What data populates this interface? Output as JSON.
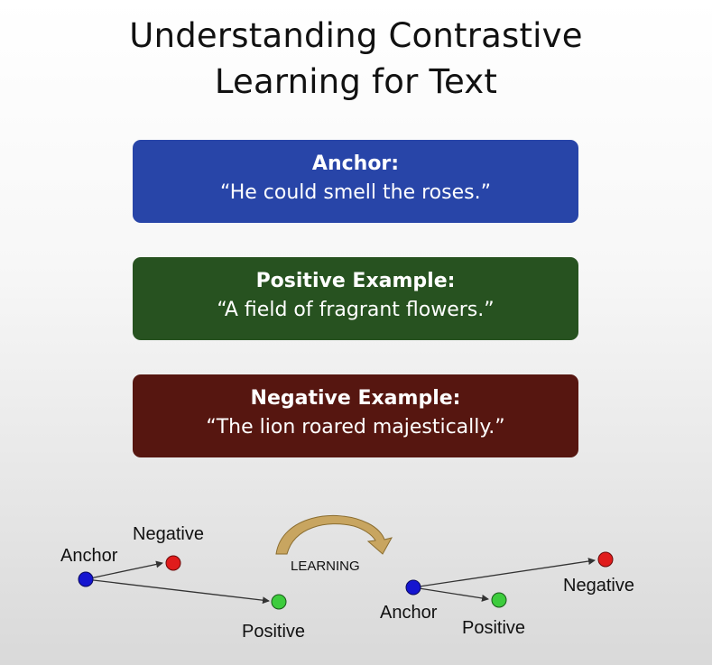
{
  "title": {
    "line1": "Understanding Contrastive",
    "line2": "Learning for Text"
  },
  "boxes": [
    {
      "label": "Anchor:",
      "quote": "“He could smell the roses.”",
      "color": "#2845a8"
    },
    {
      "label": "Positive Example:",
      "quote": "“A field of fragrant flowers.”",
      "color": "#275220"
    },
    {
      "label": "Negative Example:",
      "quote": "“The lion roared majestically.”",
      "color": "#561610"
    }
  ],
  "diagram": {
    "before": {
      "anchor": "Anchor",
      "negative": "Negative",
      "positive": "Positive"
    },
    "arrow_label": "LEARNING",
    "after": {
      "anchor": "Anchor",
      "negative": "Negative",
      "positive": "Positive"
    },
    "colors": {
      "anchor": "#1515d0",
      "negative": "#e01c1c",
      "positive": "#3dcc3d",
      "arrow": "#c8a560"
    }
  }
}
